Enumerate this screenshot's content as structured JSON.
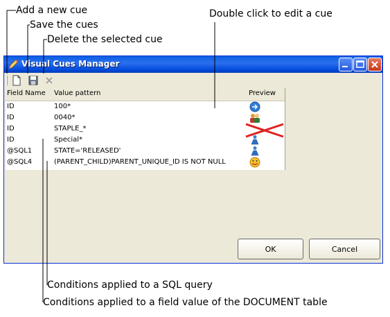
{
  "annotations": {
    "add_cue": "Add a new cue",
    "save_cues": "Save the cues",
    "delete_cue": "Delete the selected cue",
    "double_click": "Double click to edit a cue",
    "sql_conditions": "Conditions applied to a SQL query",
    "field_conditions": "Conditions applied to a field value of the DOCUMENT table"
  },
  "window": {
    "title": "Visual Cues Manager",
    "columns": [
      "Field Name",
      "Value pattern",
      "Preview"
    ],
    "rows": [
      {
        "field": "ID",
        "pattern": "100*",
        "preview_icon": "blue-arrow-icon"
      },
      {
        "field": "ID",
        "pattern": "0040*",
        "preview_icon": "people-icon"
      },
      {
        "field": "ID",
        "pattern": "STAPLE_*",
        "preview_icon": "red-x-icon"
      },
      {
        "field": "ID",
        "pattern": "Special*",
        "preview_icon": "blue-figure-icon"
      },
      {
        "field": "@SQL1",
        "pattern": "STATE='RELEASED'",
        "preview_icon": "blue-figure-icon"
      },
      {
        "field": "@SQL4",
        "pattern": "(PARENT_CHILD)PARENT_UNIQUE_ID IS NOT NULL",
        "preview_icon": "smiley-icon"
      }
    ],
    "ok_label": "OK",
    "cancel_label": "Cancel"
  },
  "colors": {
    "titlebar": "#0a5fe0",
    "dialog_bg": "#ece9d8",
    "close_button": "#c6381c"
  }
}
